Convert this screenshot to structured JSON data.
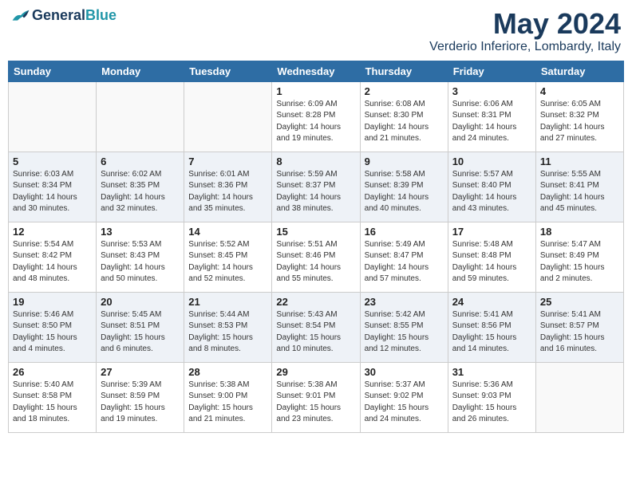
{
  "header": {
    "logo_general": "General",
    "logo_blue": "Blue",
    "month": "May 2024",
    "location": "Verderio Inferiore, Lombardy, Italy"
  },
  "days_of_week": [
    "Sunday",
    "Monday",
    "Tuesday",
    "Wednesday",
    "Thursday",
    "Friday",
    "Saturday"
  ],
  "weeks": [
    [
      {
        "day": "",
        "info": ""
      },
      {
        "day": "",
        "info": ""
      },
      {
        "day": "",
        "info": ""
      },
      {
        "day": "1",
        "info": "Sunrise: 6:09 AM\nSunset: 8:28 PM\nDaylight: 14 hours\nand 19 minutes."
      },
      {
        "day": "2",
        "info": "Sunrise: 6:08 AM\nSunset: 8:30 PM\nDaylight: 14 hours\nand 21 minutes."
      },
      {
        "day": "3",
        "info": "Sunrise: 6:06 AM\nSunset: 8:31 PM\nDaylight: 14 hours\nand 24 minutes."
      },
      {
        "day": "4",
        "info": "Sunrise: 6:05 AM\nSunset: 8:32 PM\nDaylight: 14 hours\nand 27 minutes."
      }
    ],
    [
      {
        "day": "5",
        "info": "Sunrise: 6:03 AM\nSunset: 8:34 PM\nDaylight: 14 hours\nand 30 minutes."
      },
      {
        "day": "6",
        "info": "Sunrise: 6:02 AM\nSunset: 8:35 PM\nDaylight: 14 hours\nand 32 minutes."
      },
      {
        "day": "7",
        "info": "Sunrise: 6:01 AM\nSunset: 8:36 PM\nDaylight: 14 hours\nand 35 minutes."
      },
      {
        "day": "8",
        "info": "Sunrise: 5:59 AM\nSunset: 8:37 PM\nDaylight: 14 hours\nand 38 minutes."
      },
      {
        "day": "9",
        "info": "Sunrise: 5:58 AM\nSunset: 8:39 PM\nDaylight: 14 hours\nand 40 minutes."
      },
      {
        "day": "10",
        "info": "Sunrise: 5:57 AM\nSunset: 8:40 PM\nDaylight: 14 hours\nand 43 minutes."
      },
      {
        "day": "11",
        "info": "Sunrise: 5:55 AM\nSunset: 8:41 PM\nDaylight: 14 hours\nand 45 minutes."
      }
    ],
    [
      {
        "day": "12",
        "info": "Sunrise: 5:54 AM\nSunset: 8:42 PM\nDaylight: 14 hours\nand 48 minutes."
      },
      {
        "day": "13",
        "info": "Sunrise: 5:53 AM\nSunset: 8:43 PM\nDaylight: 14 hours\nand 50 minutes."
      },
      {
        "day": "14",
        "info": "Sunrise: 5:52 AM\nSunset: 8:45 PM\nDaylight: 14 hours\nand 52 minutes."
      },
      {
        "day": "15",
        "info": "Sunrise: 5:51 AM\nSunset: 8:46 PM\nDaylight: 14 hours\nand 55 minutes."
      },
      {
        "day": "16",
        "info": "Sunrise: 5:49 AM\nSunset: 8:47 PM\nDaylight: 14 hours\nand 57 minutes."
      },
      {
        "day": "17",
        "info": "Sunrise: 5:48 AM\nSunset: 8:48 PM\nDaylight: 14 hours\nand 59 minutes."
      },
      {
        "day": "18",
        "info": "Sunrise: 5:47 AM\nSunset: 8:49 PM\nDaylight: 15 hours\nand 2 minutes."
      }
    ],
    [
      {
        "day": "19",
        "info": "Sunrise: 5:46 AM\nSunset: 8:50 PM\nDaylight: 15 hours\nand 4 minutes."
      },
      {
        "day": "20",
        "info": "Sunrise: 5:45 AM\nSunset: 8:51 PM\nDaylight: 15 hours\nand 6 minutes."
      },
      {
        "day": "21",
        "info": "Sunrise: 5:44 AM\nSunset: 8:53 PM\nDaylight: 15 hours\nand 8 minutes."
      },
      {
        "day": "22",
        "info": "Sunrise: 5:43 AM\nSunset: 8:54 PM\nDaylight: 15 hours\nand 10 minutes."
      },
      {
        "day": "23",
        "info": "Sunrise: 5:42 AM\nSunset: 8:55 PM\nDaylight: 15 hours\nand 12 minutes."
      },
      {
        "day": "24",
        "info": "Sunrise: 5:41 AM\nSunset: 8:56 PM\nDaylight: 15 hours\nand 14 minutes."
      },
      {
        "day": "25",
        "info": "Sunrise: 5:41 AM\nSunset: 8:57 PM\nDaylight: 15 hours\nand 16 minutes."
      }
    ],
    [
      {
        "day": "26",
        "info": "Sunrise: 5:40 AM\nSunset: 8:58 PM\nDaylight: 15 hours\nand 18 minutes."
      },
      {
        "day": "27",
        "info": "Sunrise: 5:39 AM\nSunset: 8:59 PM\nDaylight: 15 hours\nand 19 minutes."
      },
      {
        "day": "28",
        "info": "Sunrise: 5:38 AM\nSunset: 9:00 PM\nDaylight: 15 hours\nand 21 minutes."
      },
      {
        "day": "29",
        "info": "Sunrise: 5:38 AM\nSunset: 9:01 PM\nDaylight: 15 hours\nand 23 minutes."
      },
      {
        "day": "30",
        "info": "Sunrise: 5:37 AM\nSunset: 9:02 PM\nDaylight: 15 hours\nand 24 minutes."
      },
      {
        "day": "31",
        "info": "Sunrise: 5:36 AM\nSunset: 9:03 PM\nDaylight: 15 hours\nand 26 minutes."
      },
      {
        "day": "",
        "info": ""
      }
    ]
  ]
}
